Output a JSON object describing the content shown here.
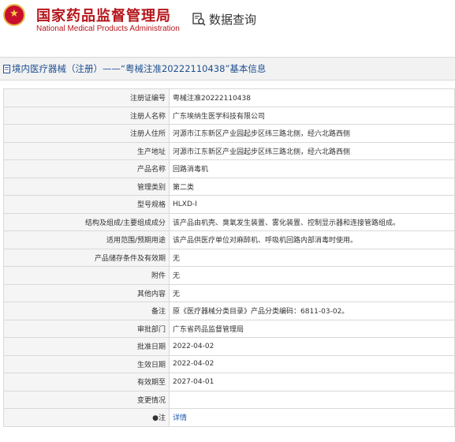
{
  "header": {
    "title_cn": "国家药品监督管理局",
    "title_en": "National Medical Products Administration",
    "query_label": "数据查询"
  },
  "breadcrumb": {
    "text": "境内医疗器械（注册）——“粤械注准20222110438”基本信息"
  },
  "rows": [
    {
      "label": "注册证编号",
      "value": "粤械注准20222110438"
    },
    {
      "label": "注册人名称",
      "value": "广东埃纳生医学科技有限公司"
    },
    {
      "label": "注册人住所",
      "value": "河源市江东新区产业园起步区纬三路北侧，经六北路西侧"
    },
    {
      "label": "生产地址",
      "value": "河源市江东新区产业园起步区纬三路北侧，经六北路西侧"
    },
    {
      "label": "产品名称",
      "value": "回路消毒机"
    },
    {
      "label": "管理类别",
      "value": "第二类"
    },
    {
      "label": "型号规格",
      "value": "HLXD-I"
    },
    {
      "label": "结构及组成/主要组成成分",
      "value": "该产品由机壳、臭氧发生装置、雾化装置、控制显示器和连接管路组成。"
    },
    {
      "label": "适用范围/预期用途",
      "value": "该产品供医疗单位对麻醉机、呼吸机回路内部消毒时使用。"
    },
    {
      "label": "产品储存条件及有效期",
      "value": "无"
    },
    {
      "label": "附件",
      "value": "无"
    },
    {
      "label": "其他内容",
      "value": "无"
    },
    {
      "label": "备注",
      "value": "原《医疗器械分类目录》产品分类编码：6811-03-02。"
    },
    {
      "label": "审批部门",
      "value": "广东省药品监督管理局"
    },
    {
      "label": "批准日期",
      "value": "2022-04-02"
    },
    {
      "label": "生效日期",
      "value": "2022-04-02"
    },
    {
      "label": "有效期至",
      "value": "2027-04-01"
    },
    {
      "label": "变更情况",
      "value": ""
    },
    {
      "label": "●注",
      "value": "详情"
    }
  ],
  "colors": {
    "brand_red": "#b5161b",
    "link_blue": "#1d4f91"
  }
}
